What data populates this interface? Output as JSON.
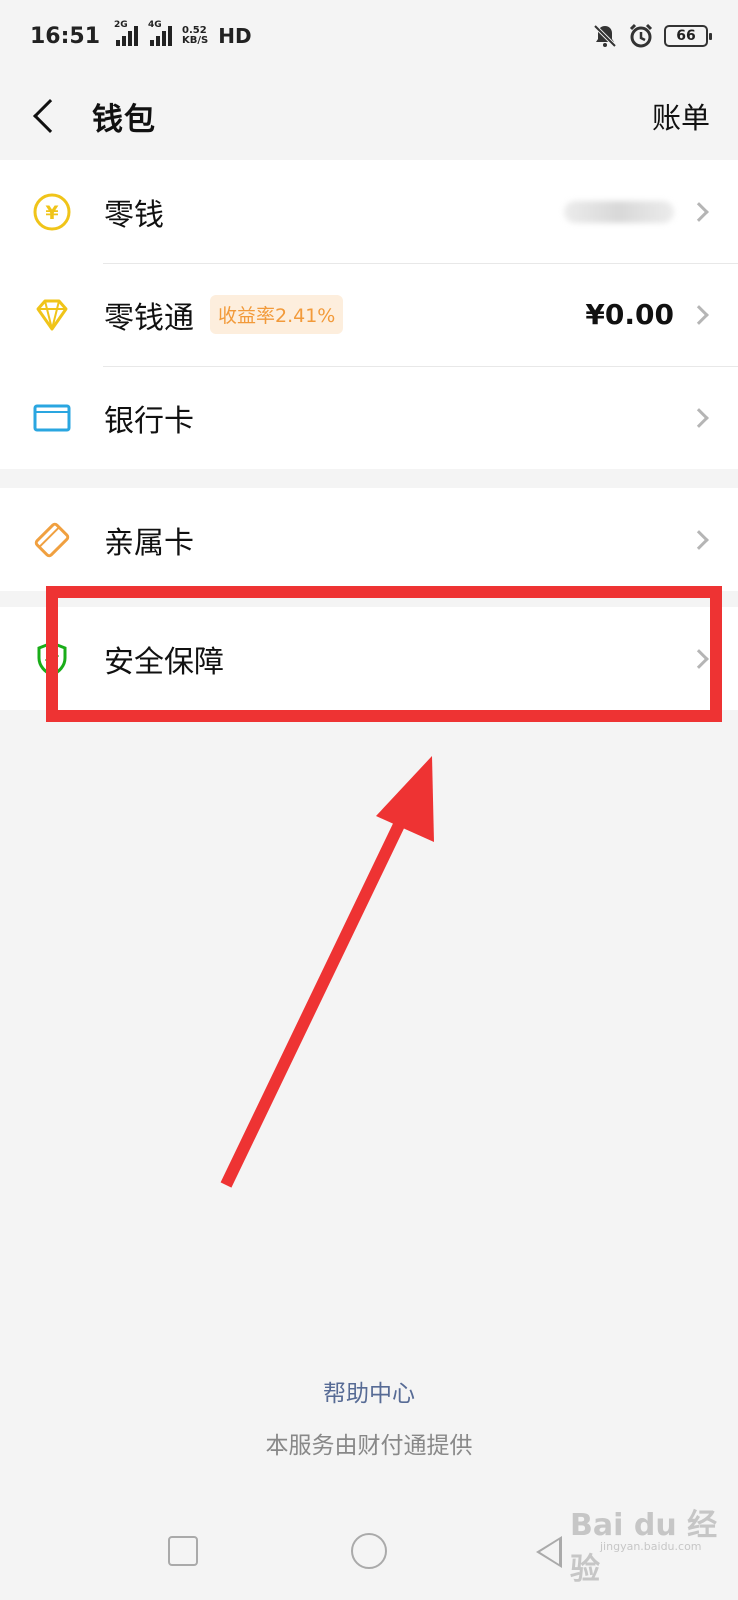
{
  "status_bar": {
    "time": "16:51",
    "sim1_label": "2G",
    "sim2_label": "4G",
    "net_speed_value": "0.52",
    "net_speed_unit": "KB/S",
    "hd_label": "HD",
    "battery": "66"
  },
  "header": {
    "title": "钱包",
    "bill_label": "账单"
  },
  "wallet_items": [
    {
      "label": "零钱",
      "icon": "yuan-coin-icon",
      "value": ""
    },
    {
      "label": "零钱通",
      "icon": "diamond-icon",
      "badge": "收益率2.41%",
      "value": "¥0.00"
    },
    {
      "label": "银行卡",
      "icon": "bank-card-icon"
    }
  ],
  "family_card": {
    "label": "亲属卡",
    "icon": "family-card-icon"
  },
  "security": {
    "label": "安全保障",
    "icon": "shield-icon"
  },
  "footer": {
    "help_link": "帮助中心",
    "provider_text": "本服务由财付通提供"
  },
  "watermark": {
    "text": "Bai du 经验",
    "sub": "jingyan.baidu.com"
  },
  "colors": {
    "accent_yellow": "#f0c419",
    "bank_blue": "#2aa6e0",
    "family_orange": "#f0a040",
    "shield_green": "#1aad19",
    "annotation_red": "#ee3333",
    "link_blue": "#576b95"
  }
}
